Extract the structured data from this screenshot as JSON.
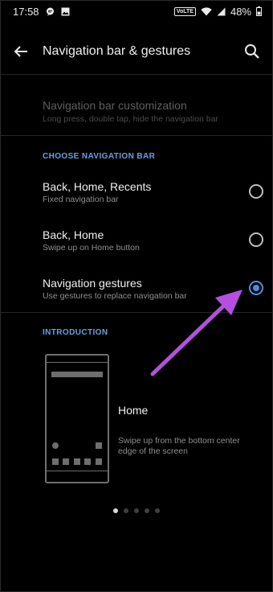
{
  "status_bar": {
    "time": "17:58",
    "left_icons": [
      "chat-bubble-icon",
      "image-icon"
    ],
    "volte": "VoLTE",
    "battery": "48%",
    "right_icons": [
      "wifi-icon",
      "signal-icon",
      "battery-icon"
    ]
  },
  "app_bar": {
    "title": "Navigation bar & gestures",
    "back_icon": "back-arrow-icon",
    "search_icon": "search-icon"
  },
  "customization": {
    "title": "Navigation bar customization",
    "subtitle": "Long press, double tap, hide the navigation bar",
    "enabled": false
  },
  "choose_section": {
    "header": "CHOOSE NAVIGATION BAR",
    "options": [
      {
        "title": "Back, Home, Recents",
        "subtitle": "Fixed navigation bar",
        "selected": false
      },
      {
        "title": "Back, Home",
        "subtitle": "Swipe up on Home button",
        "selected": false
      },
      {
        "title": "Navigation gestures",
        "subtitle": "Use gestures to replace navigation bar",
        "selected": true
      }
    ]
  },
  "introduction": {
    "header": "INTRODUCTION",
    "title": "Home",
    "description": "Swipe up from the bottom center edge of the screen",
    "pager": {
      "count": 5,
      "active_index": 0
    }
  },
  "annotation": {
    "arrow_color": "#b44fe0"
  },
  "colors": {
    "accent": "#4a90e2",
    "section_header": "#5aa3e8",
    "background": "#000000"
  }
}
